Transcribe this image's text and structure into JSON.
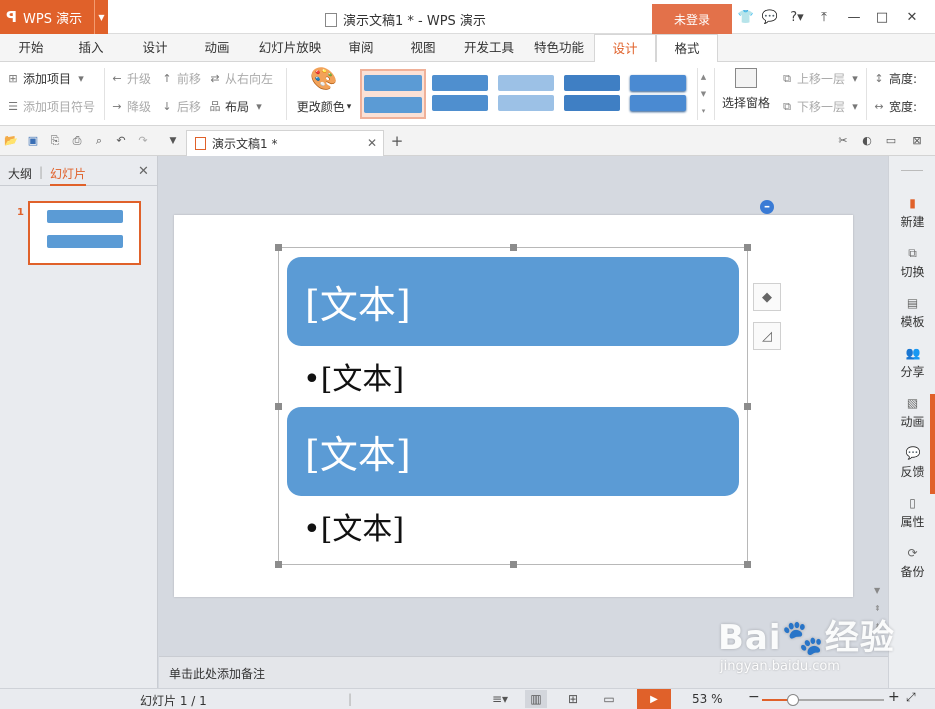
{
  "app": {
    "logo": "ꟼ",
    "name": "WPS 演示",
    "doc_title": "演示文稿1 * - WPS 演示",
    "login": "未登录",
    "controls": [
      "👕",
      "💬",
      "?▾",
      "⤒",
      "—",
      "□",
      "✕"
    ]
  },
  "menu": {
    "tabs": [
      "开始",
      "插入",
      "设计",
      "动画",
      "幻灯片放映",
      "审阅",
      "视图",
      "开发工具",
      "特色功能",
      "设计",
      "格式"
    ],
    "active_index": 9
  },
  "ribbon": {
    "add_item": "添加项目",
    "add_bullet": "添加项目符号",
    "promote": "升级",
    "demote": "降级",
    "move_up": "前移",
    "move_down": "后移",
    "rtl": "从右向左",
    "layout": "布局",
    "change_colors": "更改颜色",
    "select_pane": "选择窗格",
    "bring_forward": "上移一层",
    "send_backward": "下移一层",
    "height": "高度:",
    "width": "宽度:",
    "accent_color": "#5b9bd5"
  },
  "doc_tab": {
    "label": "演示文稿1 *"
  },
  "left_panel": {
    "tab_outline": "大纲",
    "tab_slides": "幻灯片",
    "slide_number": "1"
  },
  "slide": {
    "shape1_text": "[文本]",
    "bullet1_text": "•[文本]",
    "shape2_text": "[文本]",
    "bullet2_text": "•[文本]"
  },
  "notes": {
    "placeholder": "单击此处添加备注"
  },
  "right_sidebar": {
    "items": [
      {
        "label": "新建",
        "icon": "new-icon"
      },
      {
        "label": "切换",
        "icon": "switch-icon"
      },
      {
        "label": "模板",
        "icon": "template-icon"
      },
      {
        "label": "分享",
        "icon": "share-icon"
      },
      {
        "label": "动画",
        "icon": "animation-icon"
      },
      {
        "label": "反馈",
        "icon": "feedback-icon"
      },
      {
        "label": "属性",
        "icon": "properties-icon"
      },
      {
        "label": "备份",
        "icon": "backup-icon"
      }
    ]
  },
  "status": {
    "slide_info": "幻灯片 1 / 1",
    "zoom": "53 %",
    "zoom_level": 0.25
  },
  "watermark": {
    "brand": "Bai🐾经验",
    "url": "jingyan.baidu.com"
  }
}
